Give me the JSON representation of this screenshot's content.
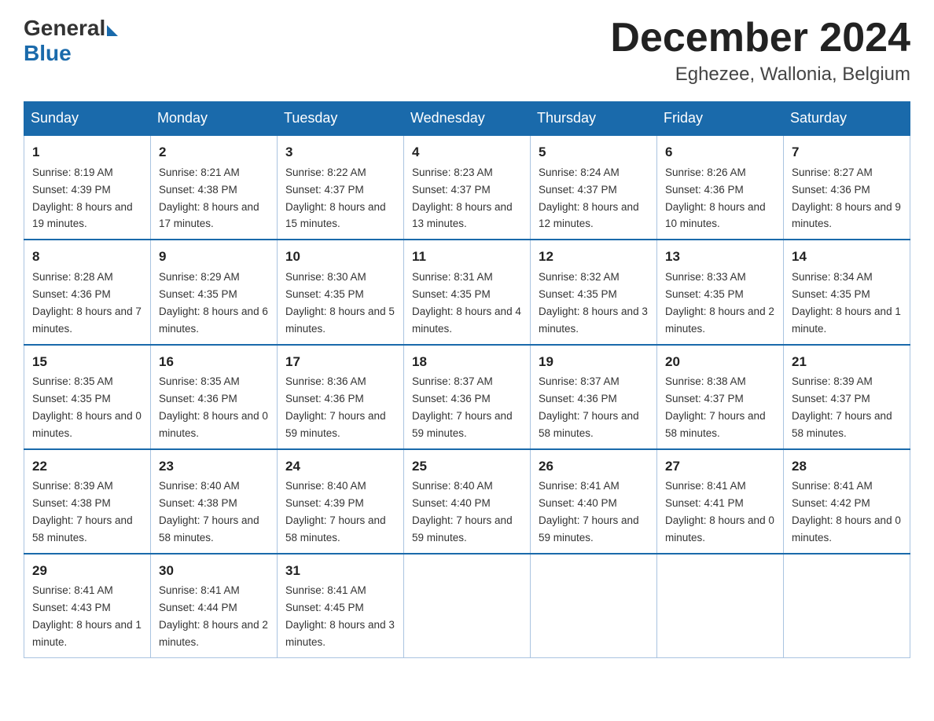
{
  "header": {
    "logo_general": "General",
    "logo_blue": "Blue",
    "month_title": "December 2024",
    "location": "Eghezee, Wallonia, Belgium"
  },
  "days_of_week": [
    "Sunday",
    "Monday",
    "Tuesday",
    "Wednesday",
    "Thursday",
    "Friday",
    "Saturday"
  ],
  "weeks": [
    [
      {
        "day": "1",
        "sunrise": "8:19 AM",
        "sunset": "4:39 PM",
        "daylight": "8 hours and 19 minutes."
      },
      {
        "day": "2",
        "sunrise": "8:21 AM",
        "sunset": "4:38 PM",
        "daylight": "8 hours and 17 minutes."
      },
      {
        "day": "3",
        "sunrise": "8:22 AM",
        "sunset": "4:37 PM",
        "daylight": "8 hours and 15 minutes."
      },
      {
        "day": "4",
        "sunrise": "8:23 AM",
        "sunset": "4:37 PM",
        "daylight": "8 hours and 13 minutes."
      },
      {
        "day": "5",
        "sunrise": "8:24 AM",
        "sunset": "4:37 PM",
        "daylight": "8 hours and 12 minutes."
      },
      {
        "day": "6",
        "sunrise": "8:26 AM",
        "sunset": "4:36 PM",
        "daylight": "8 hours and 10 minutes."
      },
      {
        "day": "7",
        "sunrise": "8:27 AM",
        "sunset": "4:36 PM",
        "daylight": "8 hours and 9 minutes."
      }
    ],
    [
      {
        "day": "8",
        "sunrise": "8:28 AM",
        "sunset": "4:36 PM",
        "daylight": "8 hours and 7 minutes."
      },
      {
        "day": "9",
        "sunrise": "8:29 AM",
        "sunset": "4:35 PM",
        "daylight": "8 hours and 6 minutes."
      },
      {
        "day": "10",
        "sunrise": "8:30 AM",
        "sunset": "4:35 PM",
        "daylight": "8 hours and 5 minutes."
      },
      {
        "day": "11",
        "sunrise": "8:31 AM",
        "sunset": "4:35 PM",
        "daylight": "8 hours and 4 minutes."
      },
      {
        "day": "12",
        "sunrise": "8:32 AM",
        "sunset": "4:35 PM",
        "daylight": "8 hours and 3 minutes."
      },
      {
        "day": "13",
        "sunrise": "8:33 AM",
        "sunset": "4:35 PM",
        "daylight": "8 hours and 2 minutes."
      },
      {
        "day": "14",
        "sunrise": "8:34 AM",
        "sunset": "4:35 PM",
        "daylight": "8 hours and 1 minute."
      }
    ],
    [
      {
        "day": "15",
        "sunrise": "8:35 AM",
        "sunset": "4:35 PM",
        "daylight": "8 hours and 0 minutes."
      },
      {
        "day": "16",
        "sunrise": "8:35 AM",
        "sunset": "4:36 PM",
        "daylight": "8 hours and 0 minutes."
      },
      {
        "day": "17",
        "sunrise": "8:36 AM",
        "sunset": "4:36 PM",
        "daylight": "7 hours and 59 minutes."
      },
      {
        "day": "18",
        "sunrise": "8:37 AM",
        "sunset": "4:36 PM",
        "daylight": "7 hours and 59 minutes."
      },
      {
        "day": "19",
        "sunrise": "8:37 AM",
        "sunset": "4:36 PM",
        "daylight": "7 hours and 58 minutes."
      },
      {
        "day": "20",
        "sunrise": "8:38 AM",
        "sunset": "4:37 PM",
        "daylight": "7 hours and 58 minutes."
      },
      {
        "day": "21",
        "sunrise": "8:39 AM",
        "sunset": "4:37 PM",
        "daylight": "7 hours and 58 minutes."
      }
    ],
    [
      {
        "day": "22",
        "sunrise": "8:39 AM",
        "sunset": "4:38 PM",
        "daylight": "7 hours and 58 minutes."
      },
      {
        "day": "23",
        "sunrise": "8:40 AM",
        "sunset": "4:38 PM",
        "daylight": "7 hours and 58 minutes."
      },
      {
        "day": "24",
        "sunrise": "8:40 AM",
        "sunset": "4:39 PM",
        "daylight": "7 hours and 58 minutes."
      },
      {
        "day": "25",
        "sunrise": "8:40 AM",
        "sunset": "4:40 PM",
        "daylight": "7 hours and 59 minutes."
      },
      {
        "day": "26",
        "sunrise": "8:41 AM",
        "sunset": "4:40 PM",
        "daylight": "7 hours and 59 minutes."
      },
      {
        "day": "27",
        "sunrise": "8:41 AM",
        "sunset": "4:41 PM",
        "daylight": "8 hours and 0 minutes."
      },
      {
        "day": "28",
        "sunrise": "8:41 AM",
        "sunset": "4:42 PM",
        "daylight": "8 hours and 0 minutes."
      }
    ],
    [
      {
        "day": "29",
        "sunrise": "8:41 AM",
        "sunset": "4:43 PM",
        "daylight": "8 hours and 1 minute."
      },
      {
        "day": "30",
        "sunrise": "8:41 AM",
        "sunset": "4:44 PM",
        "daylight": "8 hours and 2 minutes."
      },
      {
        "day": "31",
        "sunrise": "8:41 AM",
        "sunset": "4:45 PM",
        "daylight": "8 hours and 3 minutes."
      },
      null,
      null,
      null,
      null
    ]
  ]
}
